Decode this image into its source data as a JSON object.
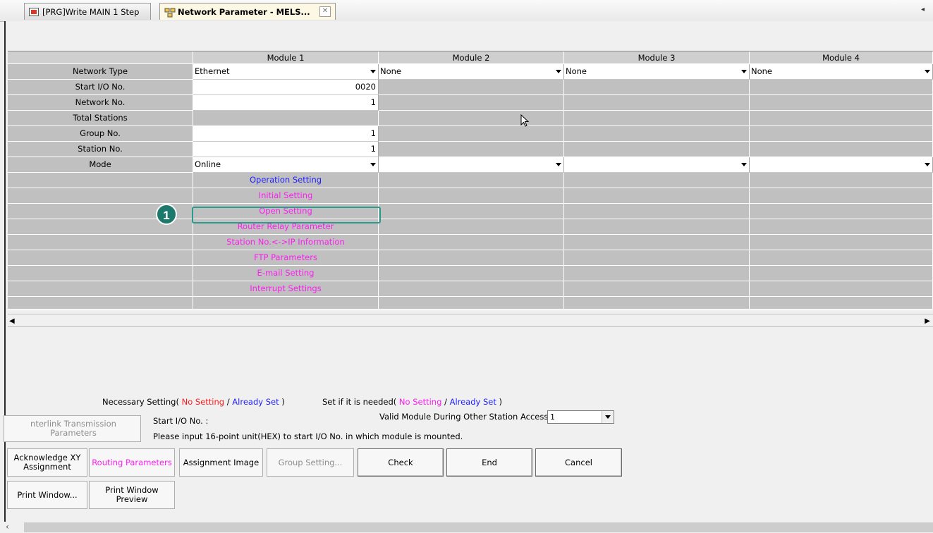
{
  "tabs": [
    {
      "label": "[PRG]Write MAIN 1 Step",
      "active": false
    },
    {
      "label": "Network Parameter - MELS...",
      "active": true
    }
  ],
  "grid": {
    "headers": [
      "",
      "Module 1",
      "Module 2",
      "Module 3",
      "Module 4"
    ],
    "rows": {
      "network_type": {
        "label": "Network Type",
        "m1": "Ethernet",
        "m2": "None",
        "m3": "None",
        "m4": "None"
      },
      "start_io": {
        "label": "Start I/O No.",
        "m1": "0020"
      },
      "network_no": {
        "label": "Network No.",
        "m1": "1"
      },
      "total_stations": {
        "label": "Total Stations"
      },
      "group_no": {
        "label": "Group No.",
        "m1": "1"
      },
      "station_no": {
        "label": "Station No.",
        "m1": "1"
      },
      "mode": {
        "label": "Mode",
        "m1": "Online"
      }
    },
    "links": [
      {
        "label": "Operation Setting",
        "color": "#1f1fff"
      },
      {
        "label": "Initial Setting",
        "color": "#ff1cf3"
      },
      {
        "label": "Open Setting",
        "color": "#ff1cf3"
      },
      {
        "label": "Router Relay Parameter",
        "color": "#ff1cf3"
      },
      {
        "label": "Station No.<->IP Information",
        "color": "#ff1cf3"
      },
      {
        "label": "FTP Parameters",
        "color": "#ff1cf3"
      },
      {
        "label": "E-mail Setting",
        "color": "#ff1cf3"
      },
      {
        "label": "Interrupt Settings",
        "color": "#ff1cf3"
      }
    ]
  },
  "annotation": {
    "marker": "1",
    "color": "#1c7a6c"
  },
  "legend": {
    "necessary_prefix": "Necessary Setting(",
    "no_setting": "No Setting",
    "slash": "/",
    "already_set": "Already Set",
    "close": ")",
    "optional_prefix": "Set if it is needed("
  },
  "info": {
    "start_io_label": "Start I/O No. :",
    "hint": "Please input 16-point unit(HEX) to start I/O No. in which module is mounted.",
    "valid_module_label": "Valid Module During Other Station Access",
    "valid_module_value": "1"
  },
  "buttons": {
    "interlink": "nterlink Transmission Parameters",
    "ack_xy": "Acknowledge XY Assignment",
    "routing": "Routing Parameters",
    "assignment_image": "Assignment Image",
    "group_setting": "Group Setting...",
    "check": "Check",
    "end": "End",
    "cancel": "Cancel",
    "print_window": "Print Window...",
    "print_preview": "Print Window Preview"
  },
  "colors": {
    "no_setting": "#ff1a1a",
    "already_set": "#1f1fff",
    "optional": "#ff1cf3"
  }
}
